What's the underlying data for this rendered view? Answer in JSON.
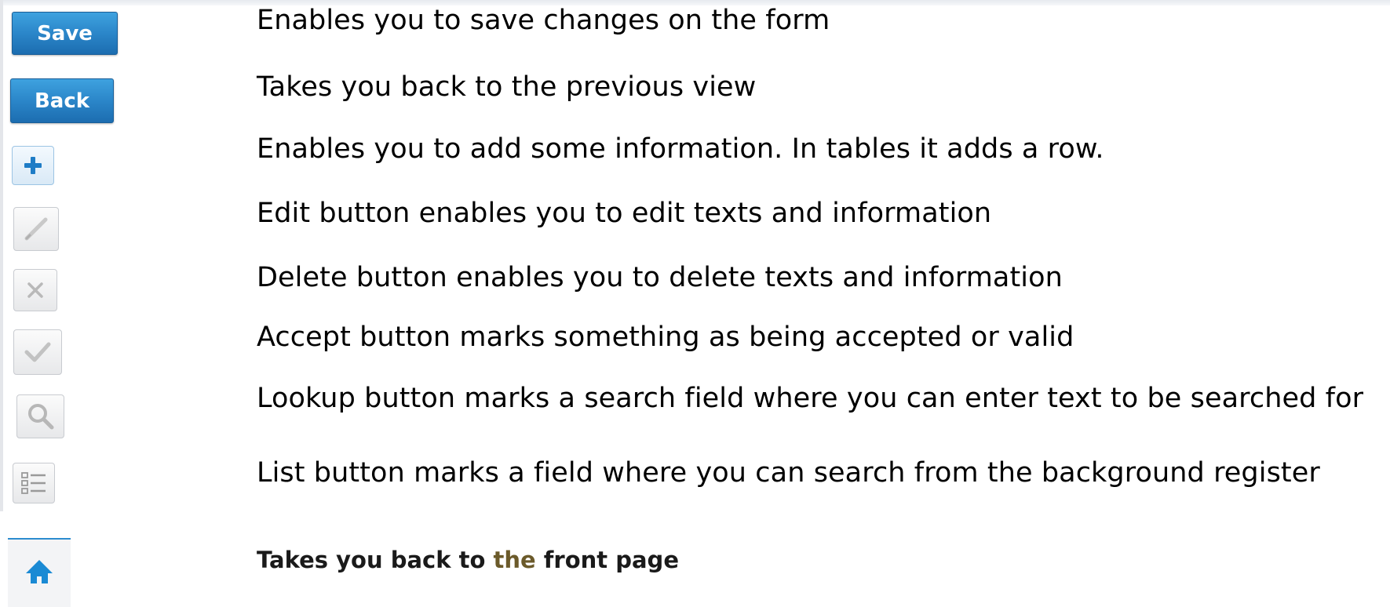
{
  "buttons": {
    "save_label": "Save",
    "back_label": "Back"
  },
  "descriptions": {
    "save": "Enables you to save changes on the form",
    "back": "Takes you back to the previous view",
    "add": "Enables you to add some information. In tables it adds a row.",
    "edit": "Edit button enables you to edit texts and information",
    "delete": "Delete button enables you to delete texts and information",
    "accept": "Accept button marks something as being accepted or valid",
    "lookup": "Lookup button marks a search field where you can enter text to be searched for",
    "list": "List button marks a field where you can search from the background register"
  },
  "home": {
    "desc_part1": "Takes you back to ",
    "desc_accent": "the",
    "desc_part2": " front page"
  },
  "icons": {
    "add": "plus-icon",
    "edit": "pencil-icon",
    "delete": "close-icon",
    "accept": "checkmark-icon",
    "lookup": "search-icon",
    "list": "list-icon",
    "home": "home-icon"
  },
  "colors": {
    "button_blue": "#2b86c9",
    "home_blue": "#1a8ad4",
    "text": "#000000",
    "accent_word": "#6b5a2a"
  }
}
